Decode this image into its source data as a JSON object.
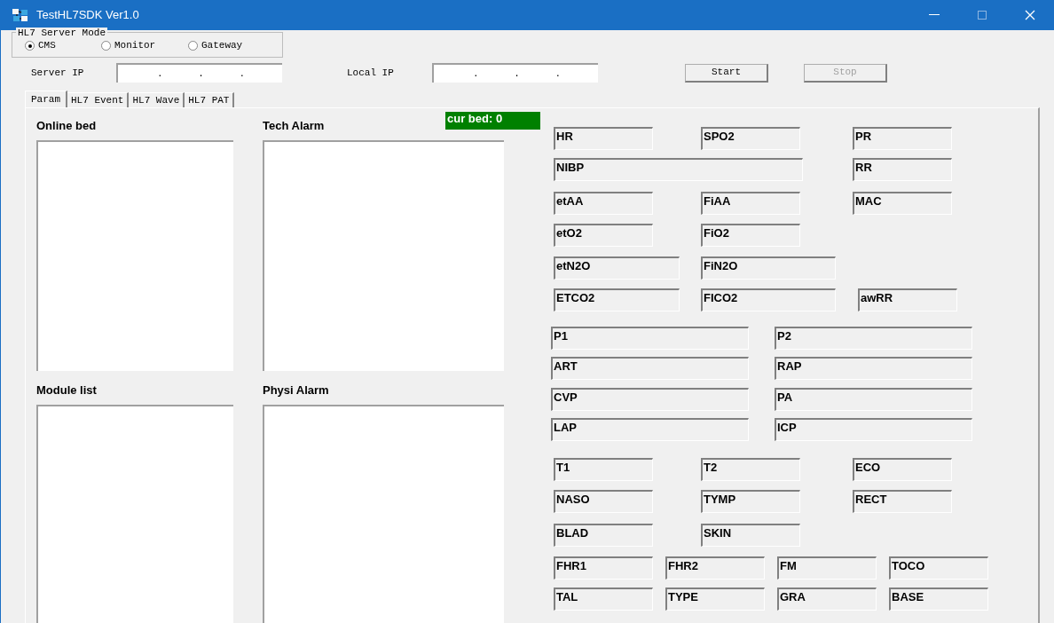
{
  "window": {
    "title": "TestHL7SDK Ver1.0"
  },
  "server_mode": {
    "title": "HL7 Server Mode",
    "options": [
      {
        "label": "CMS",
        "selected": true
      },
      {
        "label": "Monitor",
        "selected": false
      },
      {
        "label": "Gateway",
        "selected": false
      }
    ]
  },
  "server_ip": {
    "label": "Server IP",
    "value": ".      .      ."
  },
  "local_ip": {
    "label": "Local IP",
    "value": ".      .      ."
  },
  "buttons": [
    {
      "label": "Start",
      "disabled": false
    },
    {
      "label": "Stop",
      "disabled": true
    }
  ],
  "tabs": [
    {
      "label": "Param",
      "selected": true
    },
    {
      "label": "HL7 Event",
      "selected": false
    },
    {
      "label": "HL7 Wave",
      "selected": false
    },
    {
      "label": "HL7 PAT",
      "selected": false
    }
  ],
  "lists": [
    {
      "title": "Online bed"
    },
    {
      "title": "Tech Alarm"
    },
    {
      "title": "Module list"
    },
    {
      "title": "Physi Alarm"
    }
  ],
  "cur_bed": "cur bed: 0",
  "param_rows": [
    [
      "HR",
      "SPO2",
      "PR"
    ],
    [
      "NIBP",
      "RR"
    ],
    [
      "etAA",
      "FiAA",
      "MAC"
    ],
    [
      "etO2",
      "FiO2"
    ],
    [
      "etN2O",
      "FiN2O"
    ],
    [
      "ETCO2",
      "FICO2",
      "awRR"
    ],
    [
      "P1",
      "P2"
    ],
    [
      "ART",
      "RAP"
    ],
    [
      "CVP",
      "PA"
    ],
    [
      "LAP",
      "ICP"
    ],
    [
      "T1",
      "T2",
      "ECO"
    ],
    [
      "NASO",
      "TYMP",
      "RECT"
    ],
    [
      "BLAD",
      "SKIN"
    ],
    [
      "FHR1",
      "FHR2",
      "FM",
      "TOCO"
    ],
    [
      "TAL",
      "TYPE",
      "GRA",
      "BASE"
    ]
  ]
}
